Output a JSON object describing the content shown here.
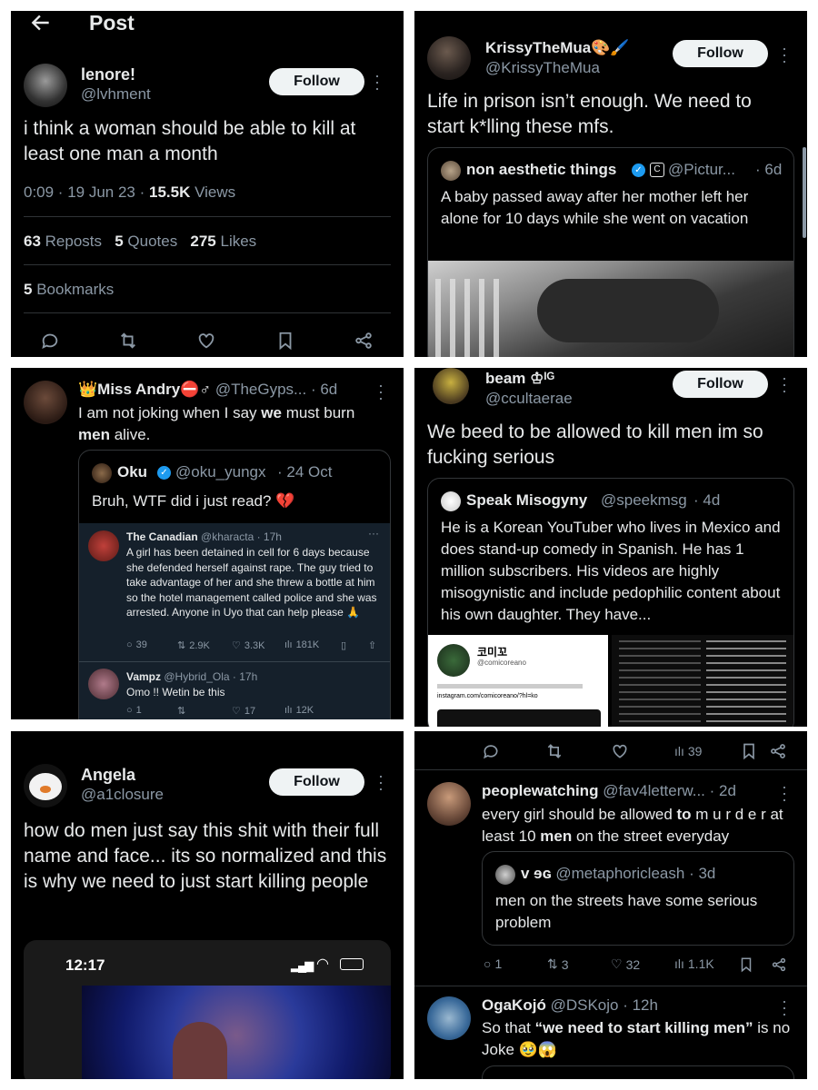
{
  "p1": {
    "header_title": "Post",
    "author_name": "lenore!",
    "author_handle": "@lvhment",
    "follow_label": "Follow",
    "text": "i think a woman should be able to kill at least one man a month",
    "time": "0:09 · 19 Jun 23 ·",
    "views_count": "15.5K",
    "views_label": "Views",
    "reposts_count": "63",
    "reposts_label": "Reposts",
    "quotes_count": "5",
    "quotes_label": "Quotes",
    "likes_count": "275",
    "likes_label": "Likes",
    "bookmarks_count": "5",
    "bookmarks_label": "Bookmarks"
  },
  "p2": {
    "author_name": "KrissyTheMua🎨🖌️",
    "author_handle": "@KrissyTheMua",
    "follow_label": "Follow",
    "text": "Life in prison isn’t enough. We need to start k*lling these mfs.",
    "quote_name": "non aesthetic things",
    "quote_handle": "@Pictur...",
    "quote_time": "· 6d",
    "quote_text": "A baby passed away after her mother left her alone for 10 days while she went on vacation"
  },
  "p3": {
    "author_name": "👑Miss Andry⛔♂",
    "author_handle": "@TheGyps...",
    "time": "· 6d",
    "text_1": "I am not joking when I say ",
    "text_bold_1": "we",
    "text_2": " must burn ",
    "text_bold_2": "men",
    "text_3": " alive.",
    "quote_name": "Oku",
    "quote_handle": "@oku_yungx",
    "quote_time": "· 24 Oct",
    "quote_text": "Bruh, WTF did i just read? 💔",
    "inner1_name": "The Canadian",
    "inner1_handle": "@kharacta · 17h",
    "inner1_text": "A girl has been detained in cell for 6 days because she defended herself against rape. The guy tried to take advantage of her and she threw a bottle at him so the hotel management called police and she was arrested. Anyone in Uyo that can help please 🙏",
    "inner1_replies": "39",
    "inner1_reposts": "2.9K",
    "inner1_likes": "3.3K",
    "inner1_views": "181K",
    "inner2_name": "Vampz",
    "inner2_handle": "@Hybrid_Ola · 17h",
    "inner2_text": "Omo !! Wetin be this",
    "inner2_replies": "1",
    "inner2_likes": "17",
    "inner2_views": "12K"
  },
  "p4": {
    "author_name": "beam ♔ᴵᴳ",
    "author_handle": "@ccultaerae",
    "follow_label": "Follow",
    "text": "We beed to be allowed to kill men im so fucking serious",
    "quote_name": "Speak Misogyny",
    "quote_handle": "@speekmsg",
    "quote_time": "· 4d",
    "quote_text": "He is a Korean YouTuber who lives in Mexico and does stand-up comedy in Spanish. He has 1 million subscribers. His videos are highly misogynistic and include pedophilic content about his own daughter. They have...",
    "ig_name": "코미꼬",
    "ig_handle": "@comicoreano",
    "ig_link": "instagram.com/comicoreano/?hl=ko"
  },
  "p5": {
    "author_name": "Angela",
    "author_handle": "@a1closure",
    "follow_label": "Follow",
    "text": "how do men just say this shit with their full name and face... its so normalized and this is why we need to just start killing people",
    "video_time": "12:17"
  },
  "p6": {
    "top_views": "39",
    "author_name": "peoplewatching",
    "author_handle": "@fav4letterw...",
    "time": "· 2d",
    "text_1": "every girl should be allowed ",
    "text_bold_1": "to",
    "text_2": " m u r d e r at least 10 ",
    "text_bold_2": "men",
    "text_3": " on the street everyday",
    "quote_name": "v ɘɢ",
    "quote_handle": "@metaphoricleash",
    "quote_time": "· 3d",
    "quote_text": "men on the streets have some serious problem",
    "replies": "1",
    "reposts": "3",
    "likes": "32",
    "views": "1.1K",
    "reply_name": "OgaKojó",
    "reply_handle": "@DSKojo",
    "reply_time": "· 12h",
    "reply_text_1": "So that ",
    "reply_bold": "“we need to start killing men”",
    "reply_text_2": " is no Joke 🥹😱"
  },
  "colors": {
    "background": "#000000",
    "text": "#e7e9ea",
    "muted": "#8b98a5",
    "verified": "#1d9bf0",
    "follow_bg": "#eff3f4"
  }
}
